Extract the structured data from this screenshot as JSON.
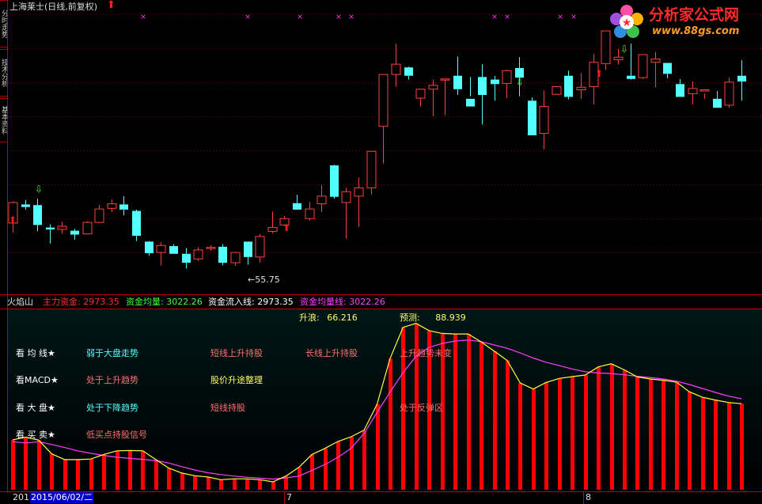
{
  "header": {
    "title": "上海莱士(日线,前复权)",
    "side_tabs": [
      "分时走势",
      "技术分析",
      "基本资料"
    ]
  },
  "logo": {
    "name": "分析家公式网",
    "url": "www.88gs.com"
  },
  "indicator_bar": {
    "name": "火焰山",
    "items": [
      {
        "label": "主力资金:",
        "value": "2973.35",
        "color": "#ff3030"
      },
      {
        "label": "资金均量:",
        "value": "3022.26",
        "color": "#40ff40"
      },
      {
        "label": "资金流入线:",
        "value": "2973.35",
        "color": "#ffffff"
      },
      {
        "label": "资金均量线:",
        "value": "3022.26",
        "color": "#ff40ff"
      }
    ],
    "rise_label": "升浪:",
    "rise_value": "66.216",
    "predict_label": "预测:",
    "predict_value": "88.939"
  },
  "low_marker": "55.75",
  "legend_rows": {
    "row1": [
      "看 均 线★",
      "弱于大盘走势",
      "短线上升持股",
      "长线上升持股",
      "上升趋势未变"
    ],
    "row2": [
      "看MACD★",
      "处于上升趋势",
      "股价升途整理"
    ],
    "row3": [
      "看 大 盘★",
      "处于下降趋势",
      "短线持股",
      "处于反弹区"
    ],
    "row4": [
      "看 买 卖★",
      "低买点持股信号"
    ]
  },
  "footer": {
    "left": "201",
    "date": "2015/06/02/二",
    "tick7": "7",
    "tick8": "8"
  },
  "colors": {
    "up": "#ff4040",
    "down": "#54ffff",
    "grid": "#800000",
    "sep": "#c00000",
    "volume": "#ff0000",
    "line1": "#ffff40",
    "line2": "#ff40ff"
  },
  "chart_data": {
    "type": "candlestick",
    "ohlc": [
      [
        62.4,
        65.8,
        60.9,
        65.6
      ],
      [
        65.3,
        66.0,
        64.5,
        64.9
      ],
      [
        65.2,
        66.2,
        61.1,
        62.1
      ],
      [
        61.7,
        62.2,
        59.2,
        61.4
      ],
      [
        61.4,
        62.6,
        60.7,
        61.9
      ],
      [
        61.2,
        61.5,
        59.8,
        60.6
      ],
      [
        60.7,
        62.7,
        60.6,
        62.5
      ],
      [
        62.5,
        65.2,
        62.4,
        64.6
      ],
      [
        64.7,
        66.1,
        64.1,
        65.4
      ],
      [
        65.3,
        66.6,
        63.6,
        64.5
      ],
      [
        64.3,
        64.5,
        59.6,
        60.4
      ],
      [
        59.5,
        59.6,
        57.3,
        57.7
      ],
      [
        57.8,
        59.4,
        55.8,
        58.9
      ],
      [
        58.8,
        59.1,
        57.6,
        57.6
      ],
      [
        57.6,
        58.5,
        55.3,
        56.2
      ],
      [
        56.8,
        58.6,
        56.5,
        58.2
      ],
      [
        58.5,
        58.9,
        58.1,
        58.6
      ],
      [
        58.7,
        59.1,
        55.8,
        56.2
      ],
      [
        56.2,
        57.9,
        55.7,
        57.8
      ],
      [
        59.5,
        59.5,
        55.9,
        57.1
      ],
      [
        57.1,
        60.7,
        56.2,
        60.3
      ],
      [
        61.1,
        64.2,
        60.8,
        61.7
      ],
      [
        62.1,
        63.5,
        62.1,
        63.1
      ],
      [
        65.5,
        66.8,
        64.9,
        64.5
      ],
      [
        63.1,
        65.7,
        62.8,
        64.6
      ],
      [
        65.4,
        68.3,
        64.1,
        66.6
      ],
      [
        71.4,
        71.5,
        66.2,
        66.5
      ],
      [
        65.6,
        67.9,
        60.0,
        67.3
      ],
      [
        66.6,
        69.5,
        61.8,
        67.9
      ],
      [
        67.9,
        72.0,
        66.9,
        73.6
      ],
      [
        77.5,
        85.5,
        71.7,
        85.6
      ],
      [
        85.6,
        90.4,
        83.7,
        87.2
      ],
      [
        86.7,
        86.8,
        84.8,
        85.4
      ],
      [
        81.9,
        83.1,
        80.6,
        83.3
      ],
      [
        83.3,
        84.8,
        79.1,
        83.9
      ],
      [
        84.9,
        84.8,
        79.3,
        84.9
      ],
      [
        85.4,
        88.4,
        82.4,
        83.3
      ],
      [
        81.8,
        85.2,
        82.2,
        80.6
      ],
      [
        85.2,
        87.2,
        77.8,
        82.4
      ],
      [
        84.8,
        85.4,
        81.5,
        84.1
      ],
      [
        84.2,
        86.3,
        81.9,
        86.2
      ],
      [
        86.6,
        88.3,
        82.2,
        85.1
      ],
      [
        81.5,
        82.0,
        76.1,
        76.1
      ],
      [
        76.4,
        83.1,
        73.9,
        80.6
      ],
      [
        82.5,
        83.3,
        82.4,
        83.7
      ],
      [
        85.4,
        86.2,
        81.7,
        82.1
      ],
      [
        83.2,
        85.8,
        81.8,
        83.6
      ],
      [
        83.7,
        88.8,
        80.9,
        87.5
      ],
      [
        87.3,
        92.1,
        86.3,
        92.4
      ],
      [
        87.9,
        89.6,
        87.2,
        88.3
      ],
      [
        85.4,
        90.4,
        84.8,
        84.9
      ],
      [
        85.1,
        87.5,
        84.9,
        88.7
      ],
      [
        87.5,
        89.1,
        83.6,
        88.0
      ],
      [
        87.4,
        87.0,
        85.0,
        85.7
      ],
      [
        84.1,
        84.9,
        82.3,
        82.1
      ],
      [
        82.6,
        84.5,
        80.9,
        83.4
      ],
      [
        83.2,
        82.6,
        81.8,
        83.2
      ],
      [
        81.8,
        83.0,
        80.4,
        80.4
      ],
      [
        80.8,
        85.1,
        80.4,
        84.4
      ],
      [
        85.4,
        87.8,
        81.5,
        84.5
      ]
    ],
    "main_force": [
      51.4,
      52.3,
      51.3,
      46.8,
      44.9,
      44.9,
      45.1,
      46.6,
      47.8,
      47.9,
      47.8,
      44.9,
      42.1,
      40.5,
      39.6,
      39.2,
      38.3,
      38.6,
      38.6,
      38.3,
      37.6,
      39.5,
      42.4,
      46.6,
      48.6,
      50.9,
      52.4,
      54.6,
      63.1,
      78.1,
      88.4,
      89.7,
      87.3,
      86.4,
      86.2,
      86.2,
      83.6,
      80.6,
      77.5,
      70.1,
      68.1,
      70.3,
      71.6,
      72.2,
      72.7,
      75.4,
      76.4,
      74.4,
      72.1,
      71.4,
      71.0,
      70.4,
      67.2,
      65.4,
      64.5,
      63.7,
      63.3
    ],
    "avg_line": [
      50.8,
      50.4,
      50.8,
      49.9,
      48.9,
      47.8,
      47.0,
      46.3,
      45.7,
      45.3,
      45.0,
      44.6,
      43.8,
      42.6,
      41.5,
      40.6,
      40.0,
      39.5,
      39.1,
      38.8,
      38.5,
      38.9,
      39.5,
      41.4,
      43.3,
      45.7,
      48.6,
      53.5,
      60.4,
      67.1,
      73.5,
      78.9,
      81.8,
      83.1,
      83.9,
      84.2,
      83.7,
      82.6,
      81.5,
      80.0,
      78.3,
      76.9,
      75.8,
      74.7,
      73.8,
      73.4,
      73.2,
      72.8,
      72.3,
      71.9,
      71.4,
      70.7,
      69.6,
      68.3,
      67.0,
      65.8,
      64.9
    ],
    "price_ylim": [
      53,
      95
    ],
    "indicator_ylim": [
      35,
      93
    ]
  }
}
